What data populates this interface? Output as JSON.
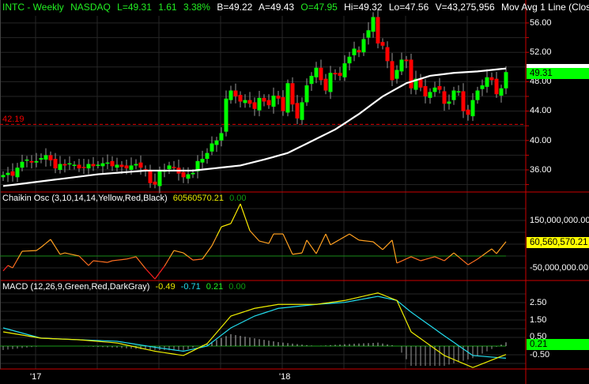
{
  "header": {
    "symbol": "INTC - Weekly",
    "exchange": "NASDAQ",
    "last": "L=49.31",
    "change": "1.61",
    "change_pct": "3.38%",
    "bid": "B=49.22",
    "ask": "A=49.43",
    "open": "O=47.95",
    "high": "Hi=49.32",
    "low": "Lo=47.56",
    "volume": "V=43,275,956",
    "study": "Mov Avg 1 Line (Clos ..."
  },
  "price_panel": {
    "support_label": "42.19",
    "last_label": "49.31",
    "axis_labels": [
      "56.00",
      "52.00",
      "48.00",
      "44.00",
      "40.00",
      "36.00"
    ]
  },
  "chaikin_panel": {
    "title": "Chaikin Osc (3,10,14,14,Yellow,Red,Black)",
    "value": "60560570.21",
    "zero": "0.00",
    "box_label": "60,560,570.21",
    "axis_labels": [
      "150,000,000.00",
      "-50,000,000.00"
    ]
  },
  "macd_panel": {
    "title": "MACD (12,26,9,Green,Red,DarkGray)",
    "macd": "-0.49",
    "signal": "-0.71",
    "hist": "0.21",
    "zero": "0.00",
    "box_label": "0.21",
    "axis_labels": [
      "2.50",
      "1.50",
      "0.50",
      "-0.50"
    ]
  },
  "x_axis": {
    "labels": [
      "'17",
      "'18"
    ]
  },
  "colors": {
    "up": "#00ff00",
    "down": "#ff0000",
    "ma": "#ffffff",
    "grid": "#262626",
    "axis": "#cc0000"
  },
  "chart_data": [
    {
      "type": "candlestick",
      "title": "INTC - Weekly",
      "support": 42.19,
      "ylim": [
        33,
        58
      ],
      "closes": [
        35.3,
        35.6,
        35.2,
        36.3,
        37.1,
        37.4,
        37.0,
        37.2,
        37.6,
        38.0,
        37.3,
        36.2,
        36.8,
        36.6,
        36.9,
        36.7,
        36.2,
        36.4,
        36.8,
        36.5,
        36.7,
        36.9,
        37.0,
        36.5,
        36.7,
        36.4,
        36.2,
        36.6,
        36.8,
        36.3,
        35.9,
        34.2,
        34.0,
        35.8,
        35.9,
        36.6,
        36.3,
        35.5,
        35.0,
        35.4,
        35.6,
        37.2,
        37.5,
        38.3,
        39.6,
        40.0,
        41.0,
        45.7,
        46.8,
        46.0,
        45.3,
        45.5,
        45.0,
        44.3,
        45.8,
        45.3,
        44.8,
        46.1,
        45.7,
        44.0,
        47.8,
        44.9,
        43.0,
        45.2,
        47.5,
        48.8,
        49.9,
        48.2,
        46.8,
        49.2,
        49.0,
        48.8,
        50.5,
        51.4,
        52.5,
        52.0,
        53.8,
        55.0,
        56.8,
        53.2,
        52.9,
        50.8,
        48.2,
        49.6,
        51.0,
        50.8,
        47.1,
        48.4,
        47.2,
        46.0,
        46.6,
        47.2,
        46.9,
        45.0,
        45.3,
        46.8,
        46.7,
        44.0,
        43.5,
        45.5,
        46.8,
        47.5,
        48.6,
        48.2,
        46.3,
        47.1,
        49.31
      ],
      "moving_average": [
        [
          0,
          33.8
        ],
        [
          10,
          34.6
        ],
        [
          20,
          35.4
        ],
        [
          30,
          35.9
        ],
        [
          40,
          35.9
        ],
        [
          50,
          36.6
        ],
        [
          55,
          37.4
        ],
        [
          60,
          38.3
        ],
        [
          70,
          41.5
        ],
        [
          75,
          43.6
        ],
        [
          80,
          46.0
        ],
        [
          85,
          47.8
        ],
        [
          90,
          48.8
        ],
        [
          95,
          49.2
        ],
        [
          100,
          49.4
        ],
        [
          106,
          49.8
        ]
      ]
    },
    {
      "type": "line",
      "title": "Chaikin Osc",
      "units": "millions",
      "ylim": [
        -95,
        200
      ],
      "points": [
        [
          0,
          -63
        ],
        [
          1,
          -40
        ],
        [
          2,
          -50
        ],
        [
          4,
          20
        ],
        [
          7,
          23
        ],
        [
          8,
          37
        ],
        [
          10,
          70
        ],
        [
          12,
          7
        ],
        [
          13,
          13
        ],
        [
          16,
          0
        ],
        [
          18,
          -40
        ],
        [
          19,
          -20
        ],
        [
          22,
          -27
        ],
        [
          23,
          -20
        ],
        [
          26,
          -13
        ],
        [
          28,
          -3
        ],
        [
          30,
          -53
        ],
        [
          32,
          -97
        ],
        [
          34,
          -43
        ],
        [
          36,
          23
        ],
        [
          38,
          13
        ],
        [
          40,
          -17
        ],
        [
          42,
          -13
        ],
        [
          44,
          43
        ],
        [
          46,
          123
        ],
        [
          48,
          137
        ],
        [
          50,
          220
        ],
        [
          52,
          107
        ],
        [
          54,
          63
        ],
        [
          56,
          53
        ],
        [
          57,
          93
        ],
        [
          59,
          93
        ],
        [
          61,
          7
        ],
        [
          63,
          13
        ],
        [
          64,
          67
        ],
        [
          66,
          10
        ],
        [
          68,
          93
        ],
        [
          69,
          47
        ],
        [
          73,
          93
        ],
        [
          75,
          67
        ],
        [
          78,
          60
        ],
        [
          80,
          27
        ],
        [
          82,
          67
        ],
        [
          83,
          -30
        ],
        [
          86,
          -3
        ],
        [
          88,
          -20
        ],
        [
          91,
          -3
        ],
        [
          93,
          -20
        ],
        [
          95,
          13
        ],
        [
          98,
          -37
        ],
        [
          100,
          -13
        ],
        [
          103,
          30
        ],
        [
          104,
          10
        ],
        [
          106,
          60.56
        ]
      ]
    },
    {
      "type": "line",
      "title": "MACD",
      "ylim": [
        -1.5,
        3.5
      ],
      "macd": [
        [
          0,
          0.83
        ],
        [
          8,
          0.46
        ],
        [
          16,
          0.37
        ],
        [
          24,
          0.18
        ],
        [
          32,
          -0.3
        ],
        [
          38,
          -0.55
        ],
        [
          43,
          0.14
        ],
        [
          48,
          1.75
        ],
        [
          53,
          2.2
        ],
        [
          58,
          2.43
        ],
        [
          66,
          2.43
        ],
        [
          72,
          2.66
        ],
        [
          79,
          3.1
        ],
        [
          83,
          2.66
        ],
        [
          86,
          0.83
        ],
        [
          93,
          -0.55
        ],
        [
          99,
          -1.25
        ],
        [
          106,
          -0.49
        ]
      ],
      "signal": [
        [
          0,
          1.06
        ],
        [
          8,
          0.46
        ],
        [
          16,
          0.37
        ],
        [
          24,
          0.28
        ],
        [
          32,
          -0.07
        ],
        [
          38,
          -0.3
        ],
        [
          43,
          0.0
        ],
        [
          48,
          1.06
        ],
        [
          53,
          1.75
        ],
        [
          58,
          2.2
        ],
        [
          66,
          2.43
        ],
        [
          72,
          2.55
        ],
        [
          79,
          2.9
        ],
        [
          83,
          2.66
        ],
        [
          86,
          1.98
        ],
        [
          93,
          0.6
        ],
        [
          99,
          -0.55
        ],
        [
          106,
          -0.71
        ]
      ]
    }
  ]
}
